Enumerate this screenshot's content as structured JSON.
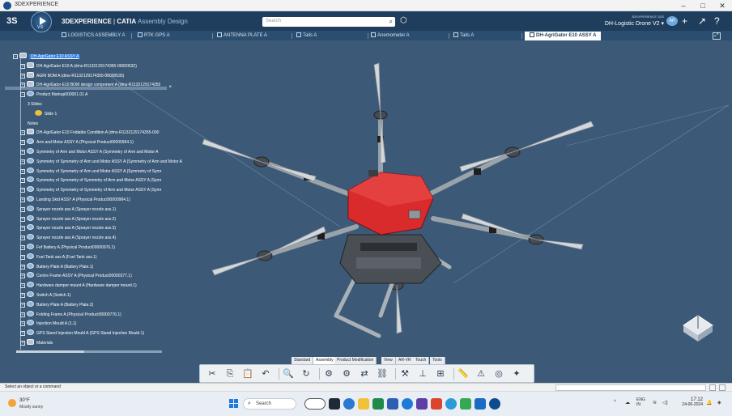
{
  "window": {
    "title": "3DEXPERIENCE",
    "controls": [
      "–",
      "□",
      "✕"
    ]
  },
  "header": {
    "compass_label": "3S",
    "version": "V.6",
    "brand": "3DEXPERIENCE",
    "product": "CATIA",
    "app": "Assembly Design",
    "search_placeholder": "Search",
    "project_small": "3DEXPERIENCE 3DS",
    "project_name": "DH-Logistic Drone V2 ▾",
    "avatar": "AP"
  },
  "tabs": [
    {
      "label": "LOGISTICS ASSEMBLY A",
      "active": false
    },
    {
      "label": "RTK GPS A",
      "active": false
    },
    {
      "label": "ANTENNA PLATE A",
      "active": false
    },
    {
      "label": "Tails A",
      "active": false
    },
    {
      "label": "Anemometer A",
      "active": false
    },
    {
      "label": "Tails A",
      "active": false
    },
    {
      "label": "DH-AgriGator E10 ASSY A",
      "active": true
    }
  ],
  "tree": {
    "nodes": [
      {
        "label": "DH-AgriGator E10 ASSY A",
        "icon": "prod",
        "pm": "–",
        "level": 0,
        "root": true
      },
      {
        "label": "DH-AgriGator E10 A (dms-R1132129174355-00000532)",
        "icon": "prod",
        "pm": "+",
        "level": 1
      },
      {
        "label": "AGRI BOM A (dms-R1132129174355-00000535)",
        "icon": "prod",
        "pm": "+",
        "level": 1
      },
      {
        "label": "DH-AgriGator E10 BOM design component A (dms-R1132129174355",
        "icon": "prod",
        "pm": "+",
        "level": 1
      },
      {
        "label": "Product Markup000001.01 A",
        "icon": "part",
        "pm": "–",
        "level": 1
      },
      {
        "label": "3 Slides",
        "icon": "",
        "pm": "",
        "level": 2
      },
      {
        "label": "Slide 1",
        "icon": "yellow",
        "pm": "",
        "level": 3
      },
      {
        "label": "Notes",
        "icon": "",
        "pm": "",
        "level": 2
      },
      {
        "label": "DH-AgriGator E10 Foldable Condition A (dms-R1132129174355-000",
        "icon": "prod",
        "pm": "+",
        "level": 1
      },
      {
        "label": "Arm and Motor ASSY A (Physical Product00000964.1)",
        "icon": "part",
        "pm": "+",
        "level": 1
      },
      {
        "label": "Symmetry of Arm and Motor ASSY A (Symmetry of Arm and Motor A",
        "icon": "part",
        "pm": "+",
        "level": 1
      },
      {
        "label": "Symmetry of Symmetry of Arm and Motor ASSY A (Symmetry of Arm and Motor A",
        "icon": "part",
        "pm": "+",
        "level": 1
      },
      {
        "label": "Symmetry of Symmetry of Arm and Motor ASSY A (Symmetry of Symr",
        "icon": "part",
        "pm": "+",
        "level": 1
      },
      {
        "label": "Symmetry of Symmetry of Symmetry of Arm and Motor ASSY A (Symr",
        "icon": "part",
        "pm": "+",
        "level": 1
      },
      {
        "label": "Symmetry of Symmetry of Symmetry of Arm and Motor ASSY A (Symr",
        "icon": "part",
        "pm": "+",
        "level": 1
      },
      {
        "label": "Landing Skid ASSY A (Physical Product00000984.1)",
        "icon": "part",
        "pm": "+",
        "level": 1
      },
      {
        "label": "Sprayer nozzle ass A (Sprayer nozzle ass.1)",
        "icon": "part",
        "pm": "+",
        "level": 1
      },
      {
        "label": "Sprayer nozzle ass A (Sprayer nozzle ass.2)",
        "icon": "part",
        "pm": "+",
        "level": 1
      },
      {
        "label": "Sprayer nozzle ass A (Sprayer nozzle ass.3)",
        "icon": "part",
        "pm": "+",
        "level": 1
      },
      {
        "label": "Sprayer nozzle ass A (Sprayer nozzle ass.4)",
        "icon": "part",
        "pm": "+",
        "level": 1
      },
      {
        "label": "Fef Battery A (Physical Product00000976.1)",
        "icon": "part",
        "pm": "+",
        "level": 1
      },
      {
        "label": "Fuel Tank ass A (Fuel Tank ass.1)",
        "icon": "part",
        "pm": "+",
        "level": 1
      },
      {
        "label": "Battery Plate A (Battery Plate.1)",
        "icon": "part",
        "pm": "+",
        "level": 1
      },
      {
        "label": "Centre Frame ASSY A (Physical Product00000277.1)",
        "icon": "part",
        "pm": "+",
        "level": 1
      },
      {
        "label": "Hardware damper mount A (Hardware damper mount.1)",
        "icon": "part",
        "pm": "+",
        "level": 1
      },
      {
        "label": "Switch A (Switch.1)",
        "icon": "part",
        "pm": "+",
        "level": 1
      },
      {
        "label": "Battery Plate A (Battery Plate.2)",
        "icon": "part",
        "pm": "+",
        "level": 1
      },
      {
        "label": "Folding Frame A (Physical Product00000776.1)",
        "icon": "part",
        "pm": "+",
        "level": 1
      },
      {
        "label": "Injection Mould A (1.1)",
        "icon": "part",
        "pm": "+",
        "level": 1
      },
      {
        "label": "GPS Stand Injection Mould A (GPS Stand Injection Mould.1)",
        "icon": "part",
        "pm": "+",
        "level": 1
      },
      {
        "label": "Materials",
        "icon": "prod",
        "pm": "+",
        "level": 1
      }
    ]
  },
  "command_tabs": [
    "Standard",
    "Assembly",
    "Product Modification",
    "View",
    "AR-VR",
    "Touch",
    "Tools"
  ],
  "active_command_tab": "Assembly",
  "toolbar_icons": [
    {
      "name": "cut-icon",
      "glyph": "✂"
    },
    {
      "name": "copy-icon",
      "glyph": "⎘"
    },
    {
      "name": "paste-icon",
      "glyph": "📋"
    },
    {
      "name": "undo-icon",
      "glyph": "↶"
    },
    {
      "name": "search-cmd-icon",
      "glyph": "🔍"
    },
    {
      "name": "update-icon",
      "glyph": "↻"
    },
    {
      "name": "insert-product-icon",
      "glyph": "⚙"
    },
    {
      "name": "insert-part-icon",
      "glyph": "⚙"
    },
    {
      "name": "replace-icon",
      "glyph": "⇄"
    },
    {
      "name": "engineering-connection-icon",
      "glyph": "⛓"
    },
    {
      "name": "mechanical-system-icon",
      "glyph": "⚒"
    },
    {
      "name": "axis-system-icon",
      "glyph": "⊥"
    },
    {
      "name": "publication-icon",
      "glyph": "⊞"
    },
    {
      "name": "measure-icon",
      "glyph": "📏"
    },
    {
      "name": "clash-icon",
      "glyph": "⚠"
    },
    {
      "name": "analysis-icon",
      "glyph": "◎"
    },
    {
      "name": "compass-tool-icon",
      "glyph": "✦"
    }
  ],
  "status": {
    "message": "Select an object or a command"
  },
  "taskbar": {
    "weather_temp": "30°F",
    "weather_cond": "Mostly sunny",
    "search_placeholder": "Search",
    "tray_lang": "ENG",
    "tray_region": "IN",
    "time": "17:12",
    "date": "24-06-2024"
  },
  "colors": {
    "appbar": "#1f3d5c",
    "viewport": "#3c5a77",
    "drone_body": "#d92b2b",
    "selection": "#2f7de1"
  }
}
